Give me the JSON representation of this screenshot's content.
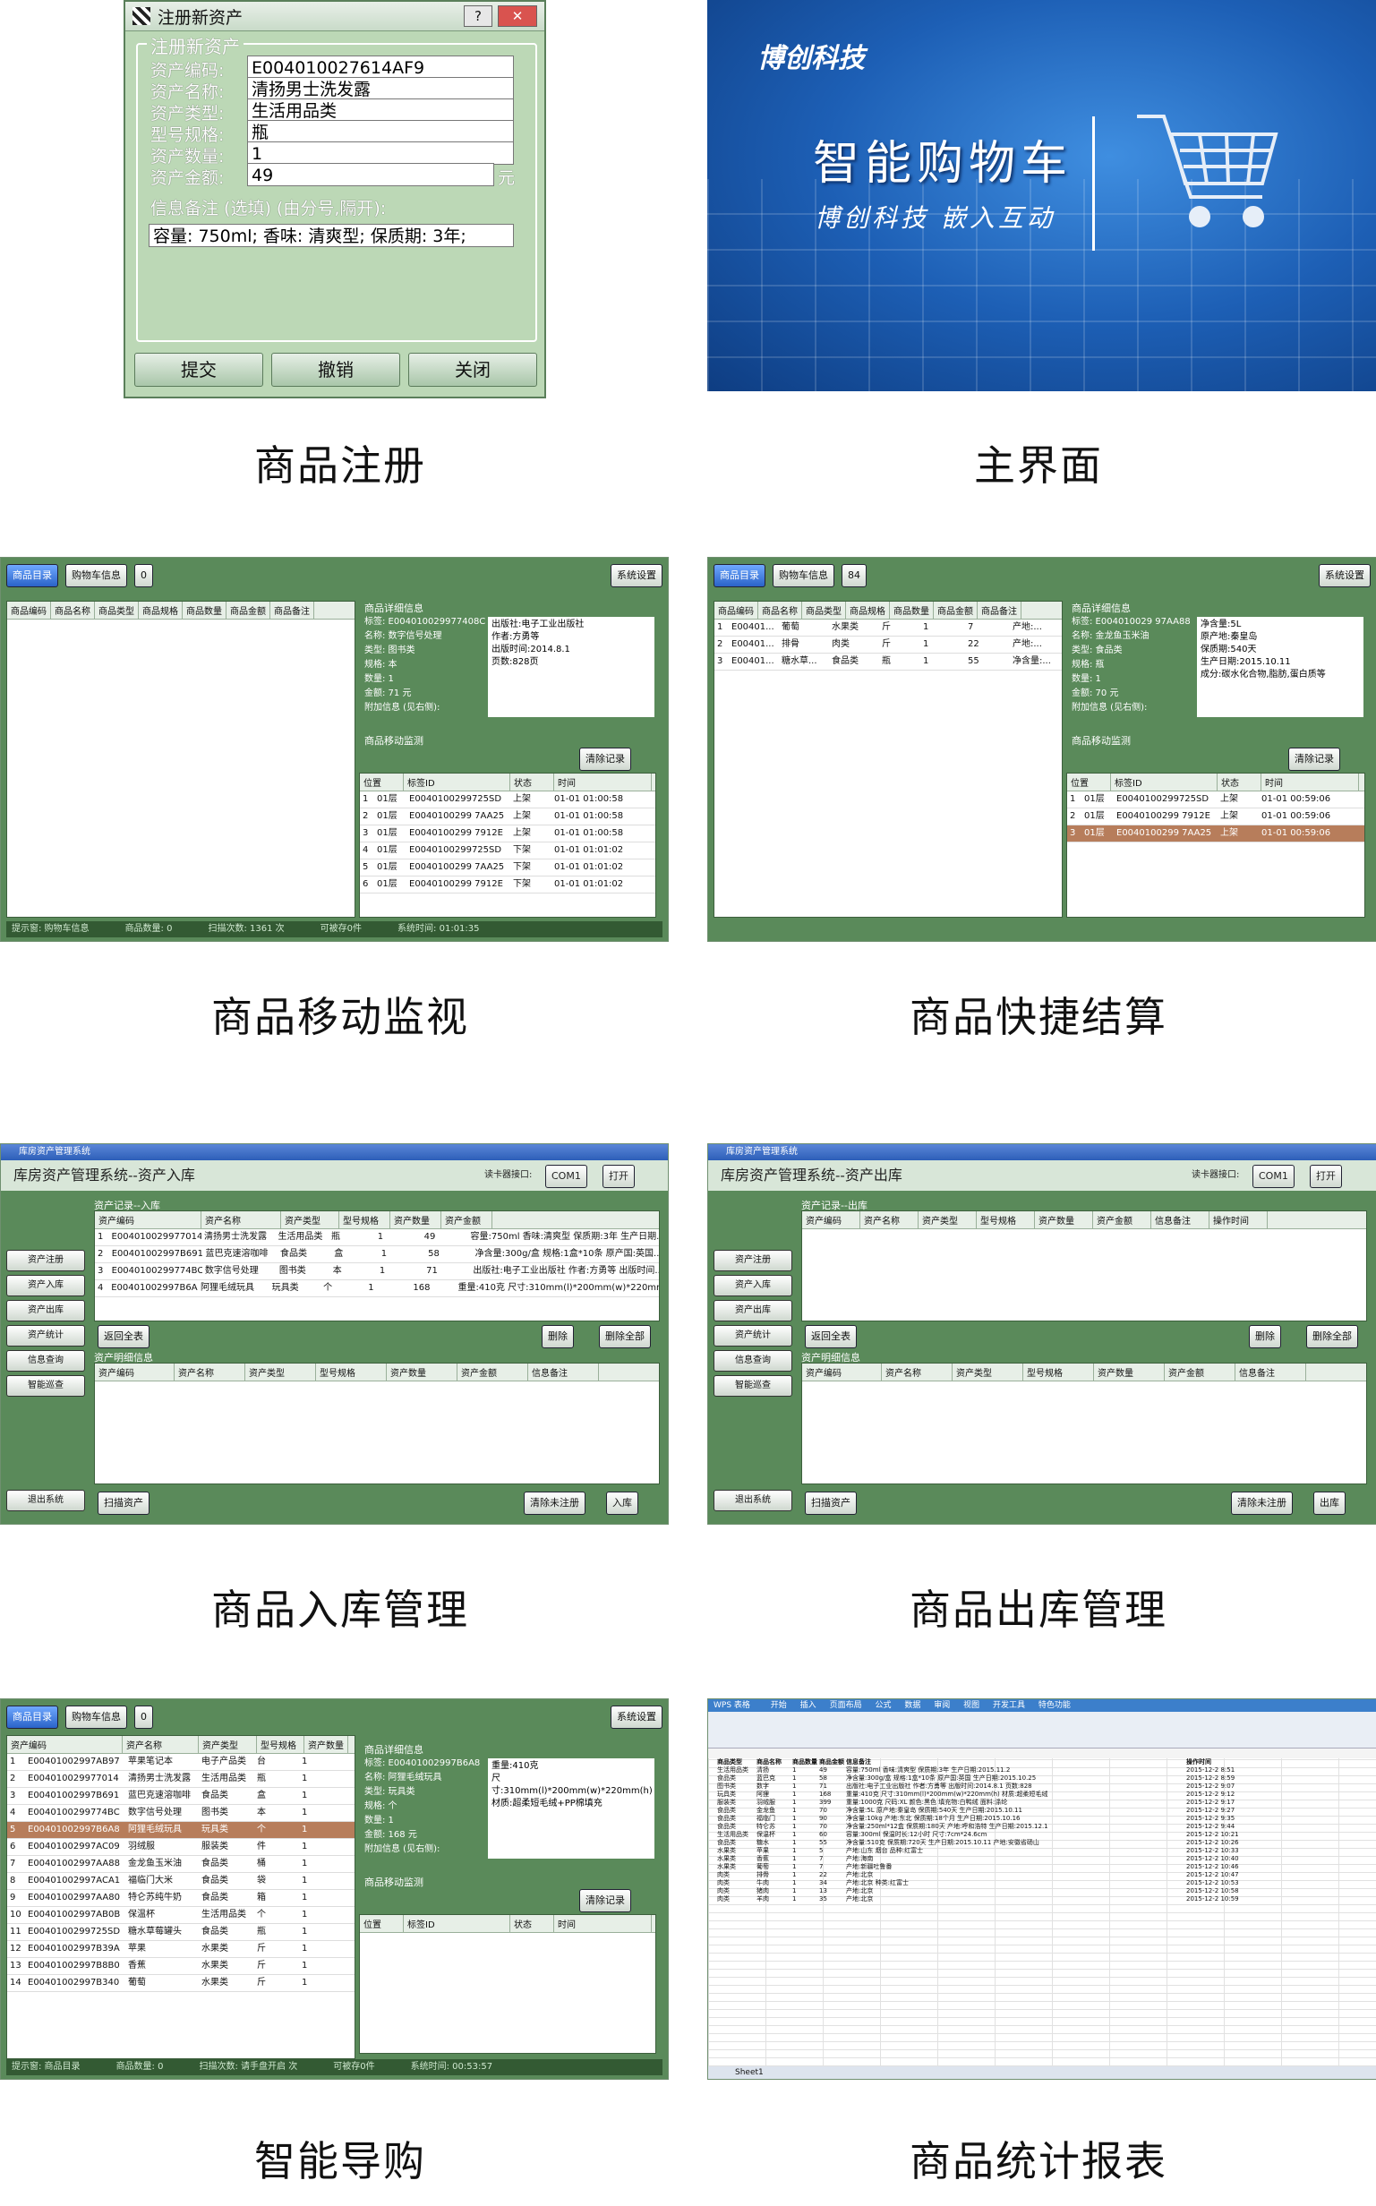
{
  "captions": {
    "p1": "商品注册",
    "p2": "主界面",
    "p3": "商品移动监视",
    "p4": "商品快捷结算",
    "p5": "商品入库管理",
    "p6": "商品出库管理",
    "p7": "智能导购",
    "p8": "商品统计报表"
  },
  "register": {
    "window_title": "注册新资产",
    "help_btn": "?",
    "close_btn": "✕",
    "group_title": "注册新资产",
    "fields": [
      {
        "label": "资产编码:",
        "value": "E004010027614AF9"
      },
      {
        "label": "资产名称:",
        "value": "清扬男士洗发露"
      },
      {
        "label": "资产类型:",
        "value": "生活用品类"
      },
      {
        "label": "型号规格:",
        "value": "瓶"
      },
      {
        "label": "资产数量:",
        "value": "1"
      },
      {
        "label": "资产金额:",
        "value": "49"
      }
    ],
    "amount_unit": "元",
    "remark_label": "信息备注 (选填) (由分号,隔开):",
    "remark_value": "容量: 750ml; 香味: 清爽型; 保质期: 3年;",
    "buttons": {
      "submit": "提交",
      "cancel": "撤销",
      "close": "关闭"
    }
  },
  "splash": {
    "logo": "博创科技",
    "title": "智能购物车",
    "subtitle": "博创科技   嵌入互动"
  },
  "monitor": {
    "tab_catalog": "商品目录",
    "tab_cart": "购物车信息",
    "count": "0",
    "settings": "系统设置",
    "columns": [
      "商品编码",
      "商品名称",
      "商品类型",
      "商品规格",
      "商品数量",
      "商品金额",
      "商品备注"
    ],
    "detail_title": "商品详细信息",
    "details": [
      "标签: E004010029977408C",
      "名称: 数字信号处理",
      "类型: 图书类",
      "规格: 本",
      "数量: 1",
      "金额: 71 元",
      "附加信息 (见右侧):"
    ],
    "extra": [
      "出版社:电子工业出版社",
      "作者:方勇等",
      "出版时间:2014.8.1",
      "页数:828页"
    ],
    "move_title": "商品移动监测",
    "clear": "清除记录",
    "move_cols": [
      "位置",
      "标签ID",
      "状态",
      "时间"
    ],
    "moves": [
      [
        "1",
        "01层",
        "E0040100299725SD",
        "上架",
        "01-01 01:00:58"
      ],
      [
        "2",
        "01层",
        "E0040100299 7AA25",
        "上架",
        "01-01 01:00:58"
      ],
      [
        "3",
        "01层",
        "E0040100299 7912E",
        "上架",
        "01-01 01:00:58"
      ],
      [
        "4",
        "01层",
        "E0040100299725SD",
        "下架",
        "01-01 01:01:02"
      ],
      [
        "5",
        "01层",
        "E0040100299 7AA25",
        "下架",
        "01-01 01:01:02"
      ],
      [
        "6",
        "01层",
        "E0040100299 7912E",
        "下架",
        "01-01 01:01:02"
      ]
    ],
    "status": [
      "提示窗: 购物车信息",
      "商品数量: 0",
      "扫描次数: 1361 次",
      "可被存0件",
      "系统时间: 01:01:35"
    ]
  },
  "checkout": {
    "tab_catalog": "商品目录",
    "tab_cart": "购物车信息",
    "count": "84",
    "settings": "系统设置",
    "columns": [
      "商品编码",
      "商品名称",
      "商品类型",
      "商品规格",
      "商品数量",
      "商品金额",
      "商品备注"
    ],
    "rows": [
      [
        "1",
        "E00401...",
        "葡萄",
        "水果类",
        "斤",
        "1",
        "7",
        "产地:..."
      ],
      [
        "2",
        "E00401...",
        "排骨",
        "肉类",
        "斤",
        "1",
        "22",
        "产地:..."
      ],
      [
        "3",
        "E00401...",
        "糖水草...",
        "食品类",
        "瓶",
        "1",
        "55",
        "净含量:..."
      ]
    ],
    "detail_title": "商品详细信息",
    "details": [
      "标签: E004010029 97AA88",
      "名称: 金龙鱼玉米油",
      "类型: 食品类",
      "规格: 瓶",
      "数量: 1",
      "金额: 70 元",
      "附加信息 (见右侧):"
    ],
    "extra": [
      "净含量:5L",
      "原产地:秦皇岛",
      "保质期:540天",
      "生产日期:2015.10.11",
      "成分:碳水化合物,脂肪,蛋白质等"
    ],
    "move_title": "商品移动监测",
    "clear": "清除记录",
    "move_cols": [
      "位置",
      "标签ID",
      "状态",
      "时间"
    ],
    "moves": [
      [
        "1",
        "01层",
        "E0040100299725SD",
        "上架",
        "01-01 00:59:06"
      ],
      [
        "2",
        "01层",
        "E0040100299 7912E",
        "上架",
        "01-01 00:59:06"
      ],
      [
        "3",
        "01层",
        "E0040100299 7AA25",
        "上架",
        "01-01 00:59:06"
      ]
    ]
  },
  "stockin": {
    "window_title": "库房资产管理系统",
    "banner": "库房资产管理系统--资产入库",
    "reader_label": "读卡器接口:",
    "port": "COM1",
    "open": "打开",
    "side": [
      "资产注册",
      "资产入库",
      "资产出库",
      "资产统计",
      "信息查询",
      "智能巡查",
      "退出系统"
    ],
    "list_title": "资产记录--入库",
    "columns": [
      "资产编码",
      "资产名称",
      "资产类型",
      "型号规格",
      "资产数量",
      "资产金额"
    ],
    "rows": [
      [
        "1",
        "E004010029977014",
        "清扬男士洗发露",
        "生活用品类",
        "瓶",
        "1",
        "49",
        "容量:750ml 香味:清爽型 保质期:3年 生产日期..."
      ],
      [
        "2",
        "E00401002997B691",
        "蓝巴克速溶咖啡",
        "食品类",
        "盒",
        "1",
        "58",
        "净含量:300g/盒 规格:1盒*10条 原产国:英国..."
      ],
      [
        "3",
        "E0040100299774BC",
        "数字信号处理",
        "图书类",
        "本",
        "1",
        "71",
        "出版社:电子工业出版社 作者:方勇等 出版时间..."
      ],
      [
        "4",
        "E00401002997B6A8",
        "阿狸毛绒玩具",
        "玩具类",
        "个",
        "1",
        "168",
        "重量:410克 尺寸:310mm(l)*200mm(w)*220mm..."
      ]
    ],
    "back": "返回全表",
    "delete": "删除",
    "delete_all": "删除全部",
    "info_title": "资产明细信息",
    "info_cols": [
      "资产编码",
      "资产名称",
      "资产类型",
      "型号规格",
      "资产数量",
      "资产金额",
      "信息备注"
    ],
    "scan": "扫描资产",
    "clear_unreg": "清除未注册",
    "confirm": "入库"
  },
  "stockout": {
    "window_title": "库房资产管理系统",
    "banner": "库房资产管理系统--资产出库",
    "reader_label": "读卡器接口:",
    "port": "COM1",
    "open": "打开",
    "side": [
      "资产注册",
      "资产入库",
      "资产出库",
      "资产统计",
      "信息查询",
      "智能巡查",
      "退出系统"
    ],
    "list_title": "资产记录--出库",
    "columns": [
      "资产编码",
      "资产名称",
      "资产类型",
      "型号规格",
      "资产数量",
      "资产金额",
      "信息备注",
      "操作时间"
    ],
    "back": "返回全表",
    "delete": "删除",
    "delete_all": "删除全部",
    "info_title": "资产明细信息",
    "info_cols": [
      "资产编码",
      "资产名称",
      "资产类型",
      "型号规格",
      "资产数量",
      "资产金额",
      "信息备注"
    ],
    "scan": "扫描资产",
    "clear_unreg": "清除未注册",
    "confirm": "出库"
  },
  "guide": {
    "tab_catalog": "商品目录",
    "tab_cart": "购物车信息",
    "count": "0",
    "settings": "系统设置",
    "columns": [
      "资产编码",
      "资产名称",
      "资产类型",
      "型号规格",
      "资产数量"
    ],
    "rows": [
      [
        "1",
        "E00401002997AB97",
        "苹果笔记本",
        "电子产品类",
        "台",
        "1"
      ],
      [
        "2",
        "E004010029977014",
        "清扬男士洗发露",
        "生活用品类",
        "瓶",
        "1"
      ],
      [
        "3",
        "E00401002997B691",
        "蓝巴克速溶咖啡",
        "食品类",
        "盒",
        "1"
      ],
      [
        "4",
        "E0040100299774BC",
        "数字信号处理",
        "图书类",
        "本",
        "1"
      ],
      [
        "5",
        "E00401002997B6A8",
        "阿狸毛绒玩具",
        "玩具类",
        "个",
        "1"
      ],
      [
        "6",
        "E00401002997AC09",
        "羽绒服",
        "服装类",
        "件",
        "1"
      ],
      [
        "7",
        "E00401002997AA88",
        "金龙鱼玉米油",
        "食品类",
        "桶",
        "1"
      ],
      [
        "8",
        "E00401002997ACA1",
        "福临门大米",
        "食品类",
        "袋",
        "1"
      ],
      [
        "9",
        "E00401002997AA80",
        "特仑苏纯牛奶",
        "食品类",
        "箱",
        "1"
      ],
      [
        "10",
        "E00401002997AB0B",
        "保温杯",
        "生活用品类",
        "个",
        "1"
      ],
      [
        "11",
        "E0040100299725SD",
        "糖水草莓罐头",
        "食品类",
        "瓶",
        "1"
      ],
      [
        "12",
        "E00401002997B39A",
        "苹果",
        "水果类",
        "斤",
        "1"
      ],
      [
        "13",
        "E00401002997B8B0",
        "香蕉",
        "水果类",
        "斤",
        "1"
      ],
      [
        "14",
        "E00401002997B340",
        "葡萄",
        "水果类",
        "斤",
        "1"
      ]
    ],
    "detail_title": "商品详细信息",
    "details": [
      "标签: E00401002997B6A8",
      "名称: 阿狸毛绒玩具",
      "类型: 玩具类",
      "规格: 个",
      "数量: 1",
      "金额: 168 元",
      "附加信息 (见右侧):"
    ],
    "extra": [
      "重量:410克",
      "尺寸:310mm(l)*200mm(w)*220mm(h)",
      "材质:超柔短毛绒+PP棉填充"
    ],
    "move_title": "商品移动监测",
    "clear": "清除记录",
    "move_cols": [
      "位置",
      "标签ID",
      "状态",
      "时间"
    ],
    "status": [
      "提示窗: 商品目录",
      "商品数量: 0",
      "扫描次数: 请手盘开启 次",
      "可被存0件",
      "系统时间: 00:53:57"
    ]
  },
  "report": {
    "app": "WPS 表格",
    "tabs": [
      "开始",
      "插入",
      "页面布局",
      "公式",
      "数据",
      "审阅",
      "视图",
      "开发工具",
      "特色功能"
    ],
    "header": [
      "商品类型",
      "商品名称",
      "商品数量",
      "商品金额",
      "信息备注",
      "操作时间"
    ],
    "rows": [
      [
        "生活用品类",
        "清扬",
        "1",
        "49",
        "容量:750ml 香味:清爽型 保质期:3年 生产日期:2015.11.2",
        "2015-12-2 8:51"
      ],
      [
        "食品类",
        "蓝巴克",
        "1",
        "58",
        "净含量:300g/盒 规格:1盒*10条 原产国:英国 生产日期:2015.10.25",
        "2015-12-2 8:59"
      ],
      [
        "图书类",
        "数字",
        "1",
        "71",
        "出版社:电子工业出版社 作者:方勇等 出版时间:2014.8.1 页数:828",
        "2015-12-2 9:07"
      ],
      [
        "玩具类",
        "阿狸",
        "1",
        "168",
        "重量:410克 尺寸:310mm(l)*200mm(w)*220mm(h) 材质:超柔短毛绒",
        "2015-12-2 9:12"
      ],
      [
        "服装类",
        "羽绒服",
        "1",
        "399",
        "重量:1000克 尺码:XL 颜色:黑色 填充物:白鸭绒 面料:涤纶",
        "2015-12-2 9:17"
      ],
      [
        "食品类",
        "金龙鱼",
        "1",
        "70",
        "净含量:5L 原产地:秦皇岛 保质期:540天 生产日期:2015.10.11",
        "2015-12-2 9:27"
      ],
      [
        "食品类",
        "福临门",
        "1",
        "90",
        "净含量:10kg 产地:东北 保质期:18个月 生产日期:2015.10.16",
        "2015-12-2 9:35"
      ],
      [
        "食品类",
        "特仑苏",
        "1",
        "70",
        "净含量:250ml*12盒 保质期:180天 产地:呼和浩特 生产日期:2015.12.1",
        "2015-12-2 9:44"
      ],
      [
        "生活用品类",
        "保温杯",
        "1",
        "60",
        "容量:300ml 保温时长:12小时 尺寸:7cm*24.6cm",
        "2015-12-2 10:21"
      ],
      [
        "食品类",
        "糖水",
        "1",
        "55",
        "净含量:510克 保质期:720天 生产日期:2015.10.11 产地:安徽省砀山",
        "2015-12-2 10:26"
      ],
      [
        "水果类",
        "苹果",
        "1",
        "5",
        "产地:山东 烟台 品种:红富士",
        "2015-12-2 10:33"
      ],
      [
        "水果类",
        "香蕉",
        "1",
        "7",
        "产地:海南",
        "2015-12-2 10:40"
      ],
      [
        "水果类",
        "葡萄",
        "1",
        "7",
        "产地:新疆吐鲁番",
        "2015-12-2 10:46"
      ],
      [
        "肉类",
        "排骨",
        "1",
        "22",
        "产地:北京",
        "2015-12-2 10:47"
      ],
      [
        "肉类",
        "牛肉",
        "1",
        "34",
        "产地:北京 种类:红富士",
        "2015-12-2 10:53"
      ],
      [
        "肉类",
        "猪肉",
        "1",
        "13",
        "产地:北京",
        "2015-12-2 10:58"
      ],
      [
        "肉类",
        "羊肉",
        "1",
        "35",
        "产地:北京",
        "2015-12-2 10:59"
      ]
    ],
    "sheet_tab": "Sheet1"
  }
}
